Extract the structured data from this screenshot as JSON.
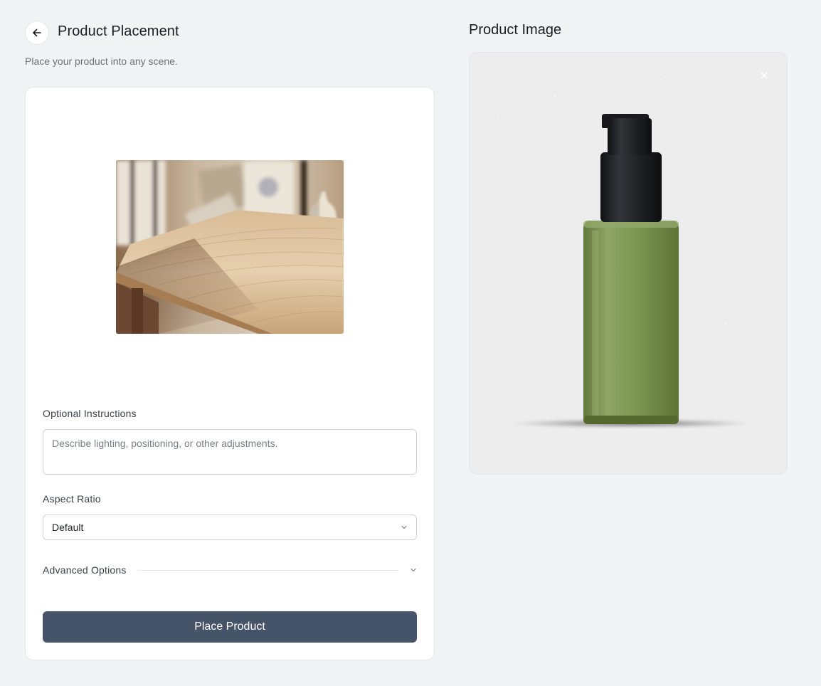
{
  "header": {
    "back_icon": "arrow-left-icon",
    "title": "Product Placement",
    "subtitle": "Place your product into any scene."
  },
  "form": {
    "instructions_label": "Optional Instructions",
    "instructions_placeholder": "Describe lighting, positioning, or other adjustments.",
    "instructions_value": "",
    "aspect_label": "Aspect Ratio",
    "aspect_value": "Default",
    "advanced_label": "Advanced Options",
    "submit_label": "Place Product"
  },
  "product": {
    "title": "Product Image",
    "close_icon": "close-icon"
  },
  "colors": {
    "background": "#f2f3f5",
    "primary_button": "#46546a",
    "bottle_green": "#7a9450",
    "pump_black": "#1c1c1e"
  }
}
